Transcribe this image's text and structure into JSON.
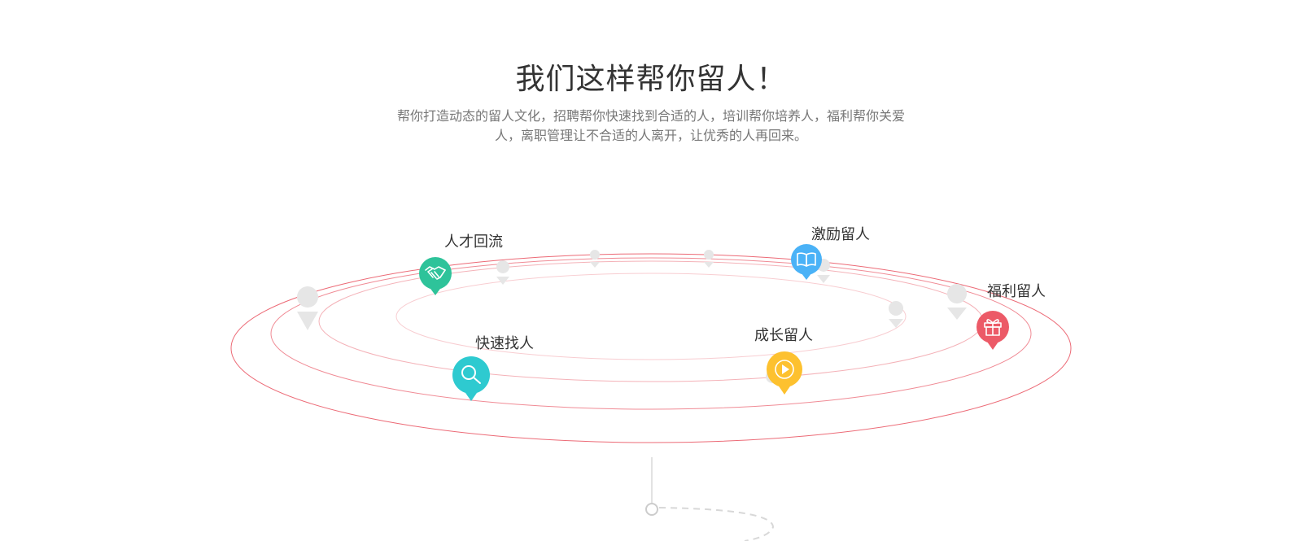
{
  "header": {
    "title": "我们这样帮你留人！",
    "description": "帮你打造动态的留人文化，招聘帮你快速找到合适的人，培训帮你培养人，福利帮你关爱人，离职管理让不合适的人离开，让优秀的人再回来。"
  },
  "pins": [
    {
      "id": "talent-return",
      "label": "人才回流",
      "color": "#2ec39a",
      "icon": "handshake-icon"
    },
    {
      "id": "quick-find",
      "label": "快速找人",
      "color": "#2ecad0",
      "icon": "search-icon"
    },
    {
      "id": "incentive",
      "label": "激励留人",
      "color": "#4ab2f7",
      "icon": "book-icon"
    },
    {
      "id": "growth",
      "label": "成长留人",
      "color": "#fdc12f",
      "icon": "play-icon"
    },
    {
      "id": "welfare",
      "label": "福利留人",
      "color": "#ec5a67",
      "icon": "gift-icon"
    }
  ],
  "colors": {
    "orbit": "#e94e5d",
    "placeholder": "#e6e6e6",
    "connector": "#cccccc"
  }
}
